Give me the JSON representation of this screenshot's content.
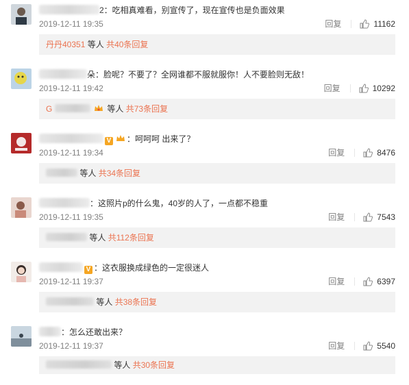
{
  "comments": [
    {
      "text": "2：吃相真难看，别宣传了，现在宣传也是负面效果",
      "time": "2019-12-11 19:35",
      "reply": "回复",
      "likes": "11162",
      "sub_nick": "丹丹40351",
      "sub_etc": "等人",
      "sub_more": "共40条回复",
      "avatar_color": "#8a9aa8"
    },
    {
      "text": "朵：脸呢？不要了？全网谁都不服就服你！人不要脸则无敌！",
      "time": "2019-12-11 19:42",
      "reply": "回复",
      "likes": "10292",
      "sub_nick": "G",
      "sub_etc": "等人",
      "sub_more": "共73条回复",
      "avatar_color": "#e6d64a"
    },
    {
      "text": "：呵呵呵 出来了？",
      "time": "2019-12-11 19:34",
      "reply": "回复",
      "likes": "8476",
      "sub_nick": "",
      "sub_etc": "等人",
      "sub_more": "共34条回复",
      "avatar_color": "#b52a2a"
    },
    {
      "text": "：这照片p的什么鬼，40岁的人了，一点都不稳重",
      "time": "2019-12-11 19:35",
      "reply": "回复",
      "likes": "7543",
      "sub_nick": "",
      "sub_etc": "等人",
      "sub_more": "共112条回复",
      "avatar_color": "#c98a7a"
    },
    {
      "text": "：这衣服换成绿色的一定很迷人",
      "time": "2019-12-11 19:37",
      "reply": "回复",
      "likes": "6397",
      "sub_nick": "",
      "sub_etc": "等人",
      "sub_more": "共38条回复",
      "avatar_color": "#d9c7c0"
    },
    {
      "text": "：怎么还敢出来？",
      "time": "2019-12-11 19:37",
      "reply": "回复",
      "likes": "5540",
      "sub_nick": "",
      "sub_etc": "等人",
      "sub_more": "共30条回复",
      "avatar_color": "#8fa3b3"
    }
  ]
}
